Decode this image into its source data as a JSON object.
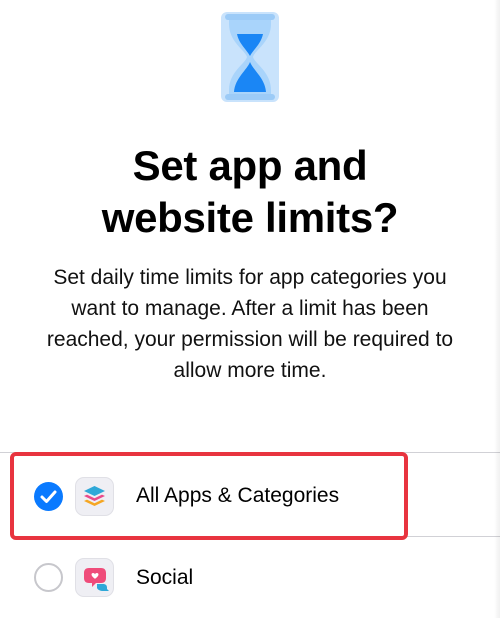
{
  "header": {
    "icon": "hourglass-icon",
    "title_line1": "Set app and",
    "title_line2": "website limits?",
    "description": "Set daily time limits for app categories you want to manage. After a limit has been reached, your permission will be required to allow more time."
  },
  "categories": [
    {
      "label": "All Apps & Categories",
      "checked": true,
      "icon": "all-apps-stack-icon"
    },
    {
      "label": "Social",
      "checked": false,
      "icon": "social-chat-bubbles-icon"
    }
  ],
  "colors": {
    "accent": "#0a7aff",
    "highlight": "#e8343f",
    "hourglass_light": "#a9d4fb",
    "hourglass_dark": "#1a86f5"
  }
}
